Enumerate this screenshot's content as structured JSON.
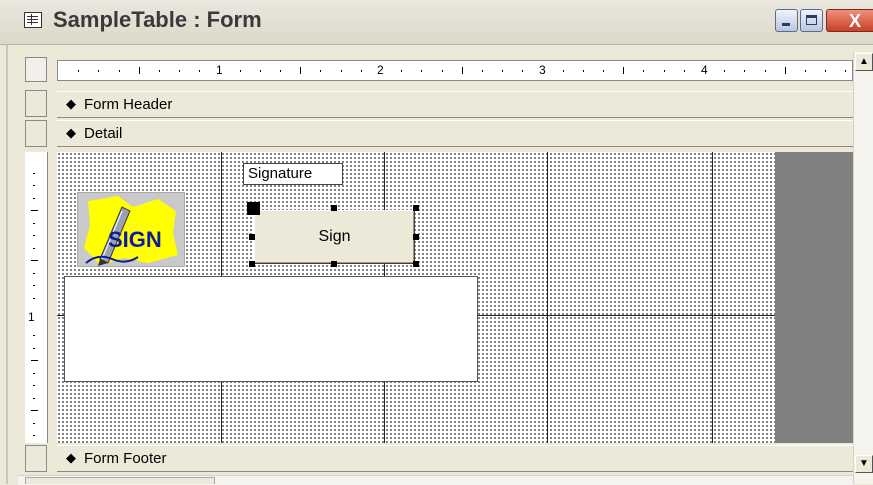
{
  "window": {
    "title": "SampleTable : Form",
    "close_glyph": "X"
  },
  "ruler": {
    "marks": [
      "1",
      "2",
      "3",
      "4"
    ],
    "vertical_marks": [
      "1"
    ]
  },
  "sections": {
    "form_header": "Form Header",
    "detail": "Detail",
    "form_footer": "Form Footer"
  },
  "controls": {
    "image_text": "SIGN",
    "signature_label": "Signature",
    "sign_button": "Sign"
  },
  "icons": {
    "app": "form-icon",
    "section": "section-arrow-icon",
    "scroll_up": "up-arrow-icon",
    "scroll_down": "down-arrow-icon"
  },
  "colors": {
    "title_text": "#3a3a3a",
    "close_button": "#c8402a",
    "detail_background": "#ffffff",
    "detail_outside": "#808080",
    "image_background": "#ffff00",
    "image_text": "#0b1c9c"
  }
}
